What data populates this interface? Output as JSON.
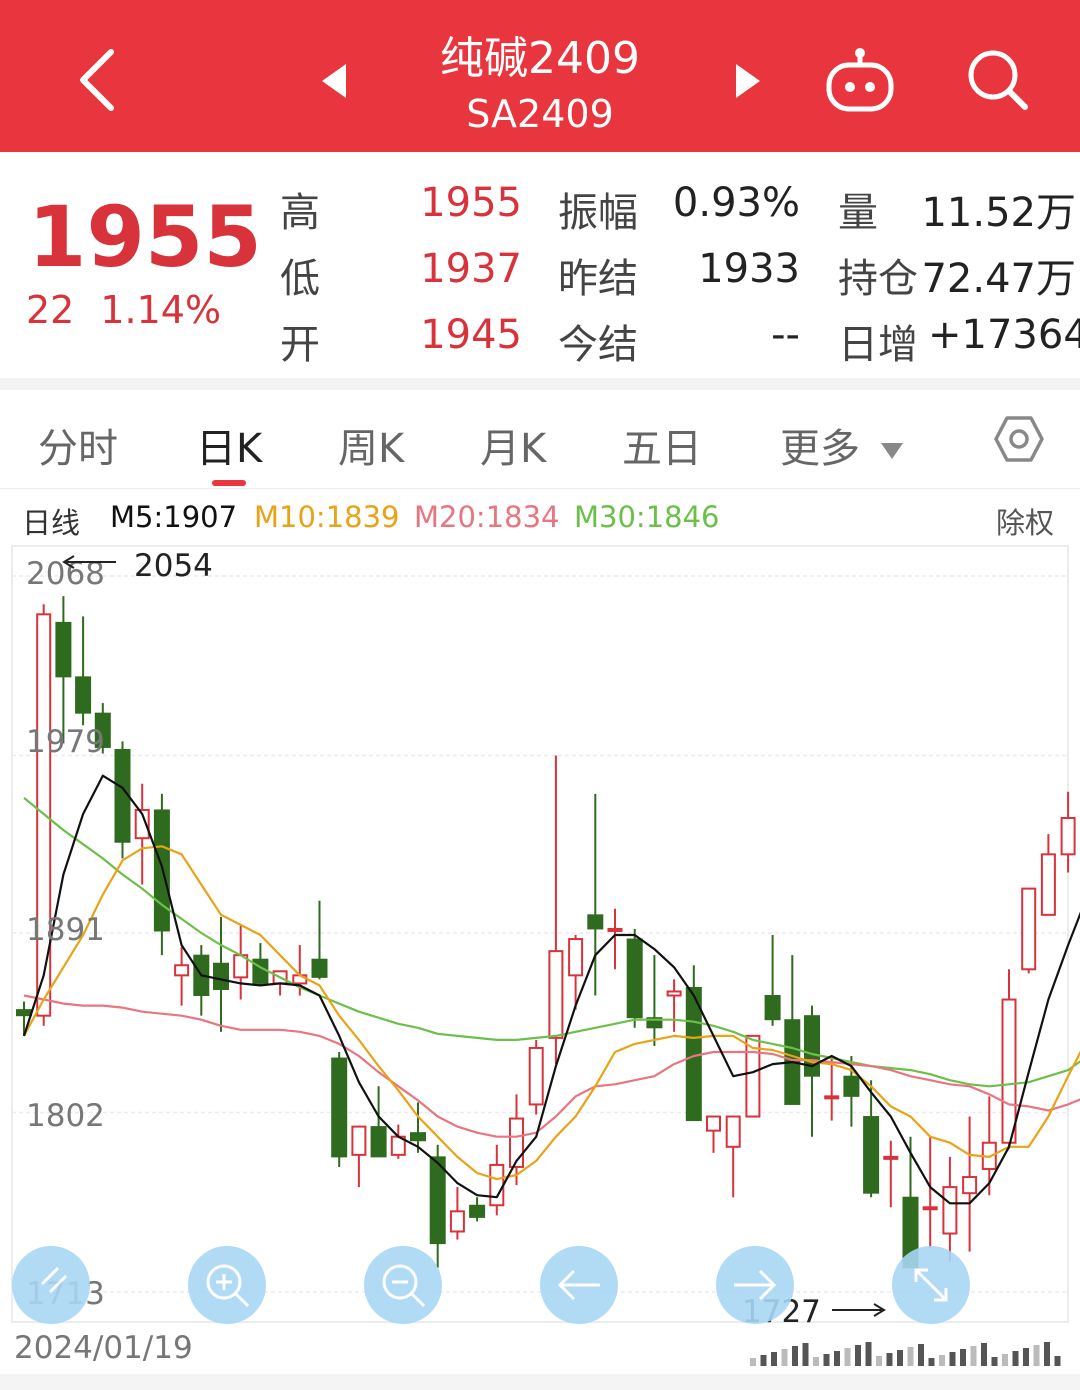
{
  "header": {
    "title": "纯碱2409",
    "subtitle": "SA2409"
  },
  "quote": {
    "price": "1955",
    "change": "22",
    "change_pct": "1.14%",
    "fields": [
      {
        "label": "高",
        "value": "1955"
      },
      {
        "label": "低",
        "value": "1937"
      },
      {
        "label": "开",
        "value": "1945"
      },
      {
        "label": "振幅",
        "value": "0.93%"
      },
      {
        "label": "昨结",
        "value": "1933"
      },
      {
        "label": "今结",
        "value": "--"
      },
      {
        "label": "量",
        "value": "11.52万"
      },
      {
        "label": "持仓",
        "value": "72.47万"
      },
      {
        "label": "日增",
        "value": "+17364"
      }
    ]
  },
  "tabs": [
    {
      "label": "分时"
    },
    {
      "label": "日K"
    },
    {
      "label": "周K"
    },
    {
      "label": "月K"
    },
    {
      "label": "五日"
    },
    {
      "label": "更多"
    }
  ],
  "ma_legend": {
    "period": "日线",
    "m5": "M5:1907",
    "m10": "M10:1839",
    "m20": "M20:1834",
    "m30": "M30:1846",
    "adjust": "除权"
  },
  "colors": {
    "up": "#d8323a",
    "down": "#2e6b1f",
    "m5": "#111111",
    "m10": "#e8a317",
    "m20": "#e8757f",
    "m30": "#6cc04a",
    "accent": "#e8353e"
  },
  "chart_data": {
    "type": "candlestick",
    "y_ticks": [
      "2068",
      "1979",
      "1891",
      "1802",
      "1713"
    ],
    "ylim": [
      1705,
      2080
    ],
    "annotations": {
      "max": "2054",
      "min": "1727"
    },
    "start_date": "2024/01/19",
    "candles": [
      [
        1853,
        1857,
        1840,
        1850
      ],
      [
        1850,
        2054,
        1845,
        2049
      ],
      [
        2045,
        2058,
        1985,
        2018
      ],
      [
        2018,
        2048,
        1994,
        2000
      ],
      [
        2000,
        2005,
        1980,
        1983
      ],
      [
        1982,
        1986,
        1928,
        1936
      ],
      [
        1938,
        1965,
        1915,
        1952
      ],
      [
        1952,
        1960,
        1880,
        1892
      ],
      [
        1870,
        1884,
        1855,
        1875
      ],
      [
        1880,
        1885,
        1850,
        1860
      ],
      [
        1876,
        1899,
        1842,
        1863
      ],
      [
        1869,
        1895,
        1858,
        1880
      ],
      [
        1878,
        1886,
        1865,
        1866
      ],
      [
        1866,
        1872,
        1860,
        1872
      ],
      [
        1866,
        1885,
        1860,
        1870
      ],
      [
        1878,
        1907,
        1868,
        1869
      ],
      [
        1829,
        1832,
        1775,
        1780
      ],
      [
        1781,
        1794,
        1765,
        1795
      ],
      [
        1795,
        1815,
        1780,
        1780
      ],
      [
        1781,
        1796,
        1779,
        1790
      ],
      [
        1792,
        1807,
        1782,
        1788
      ],
      [
        1780,
        1786,
        1725,
        1737
      ],
      [
        1743,
        1765,
        1739,
        1753
      ],
      [
        1756,
        1760,
        1748,
        1750
      ],
      [
        1756,
        1786,
        1751,
        1776
      ],
      [
        1775,
        1811,
        1766,
        1799
      ],
      [
        1806,
        1838,
        1801,
        1834
      ],
      [
        1839,
        1979,
        1826,
        1882
      ],
      [
        1870,
        1890,
        1853,
        1888
      ],
      [
        1900,
        1960,
        1860,
        1893
      ],
      [
        1893,
        1903,
        1873,
        1893
      ],
      [
        1888,
        1893,
        1844,
        1849
      ],
      [
        1849,
        1880,
        1835,
        1844
      ],
      [
        1860,
        1868,
        1842,
        1862
      ],
      [
        1864,
        1875,
        1810,
        1798
      ],
      [
        1793,
        1800,
        1782,
        1800
      ],
      [
        1785,
        1800,
        1760,
        1800
      ],
      [
        1800,
        1840,
        1800,
        1840
      ],
      [
        1860,
        1890,
        1845,
        1848
      ],
      [
        1848,
        1880,
        1830,
        1806
      ],
      [
        1850,
        1855,
        1790,
        1820
      ],
      [
        1809,
        1830,
        1798,
        1810
      ],
      [
        1820,
        1830,
        1795,
        1810
      ],
      [
        1800,
        1818,
        1760,
        1762
      ],
      [
        1780,
        1788,
        1755,
        1780
      ],
      [
        1760,
        1790,
        1725,
        1725
      ],
      [
        1755,
        1790,
        1735,
        1755
      ],
      [
        1742,
        1780,
        1728,
        1765
      ],
      [
        1762,
        1800,
        1733,
        1770
      ],
      [
        1774,
        1810,
        1761,
        1787
      ],
      [
        1787,
        1873,
        1784,
        1858
      ],
      [
        1873,
        1903,
        1871,
        1913
      ],
      [
        1900,
        1940,
        1900,
        1930
      ],
      [
        1930,
        1961,
        1921,
        1948
      ],
      [
        1945,
        1955,
        1937,
        1955
      ]
    ],
    "m5": [
      1840,
      1870,
      1920,
      1950,
      1969,
      1963,
      1950,
      1924,
      1885,
      1870,
      1868,
      1866,
      1865,
      1866,
      1865,
      1860,
      1840,
      1817,
      1800,
      1790,
      1785,
      1777,
      1767,
      1761,
      1760,
      1778,
      1790,
      1825,
      1855,
      1880,
      1890,
      1890,
      1883,
      1874,
      1860,
      1840,
      1820,
      1822,
      1826,
      1827,
      1825,
      1830,
      1825,
      1812,
      1800,
      1782,
      1765,
      1757,
      1757,
      1767,
      1785,
      1822,
      1858,
      1885,
      1910
    ],
    "m10": [
      1840,
      1858,
      1874,
      1890,
      1910,
      1927,
      1933,
      1934,
      1930,
      1915,
      1900,
      1895,
      1890,
      1880,
      1870,
      1865,
      1850,
      1838,
      1825,
      1813,
      1800,
      1790,
      1780,
      1772,
      1769,
      1771,
      1778,
      1790,
      1800,
      1815,
      1832,
      1836,
      1838,
      1840,
      1839,
      1840,
      1840,
      1834,
      1833,
      1830,
      1827,
      1826,
      1823,
      1815,
      1805,
      1800,
      1790,
      1787,
      1781,
      1780,
      1785,
      1785,
      1800,
      1820,
      1839
    ],
    "m20": [
      1860,
      1858,
      1856,
      1855,
      1855,
      1854,
      1852,
      1851,
      1850,
      1848,
      1845,
      1843,
      1843,
      1843,
      1842,
      1840,
      1836,
      1830,
      1822,
      1815,
      1808,
      1800,
      1795,
      1792,
      1790,
      1790,
      1792,
      1800,
      1810,
      1815,
      1816,
      1818,
      1820,
      1826,
      1830,
      1832,
      1832,
      1832,
      1831,
      1828,
      1828,
      1827,
      1826,
      1825,
      1823,
      1820,
      1818,
      1816,
      1815,
      1811,
      1806,
      1805,
      1803,
      1806,
      1810
    ],
    "m30": [
      1958,
      1950,
      1942,
      1935,
      1928,
      1920,
      1913,
      1905,
      1898,
      1891,
      1885,
      1880,
      1874,
      1869,
      1864,
      1860,
      1856,
      1852,
      1849,
      1846,
      1844,
      1841,
      1840,
      1839,
      1838,
      1838,
      1839,
      1840,
      1842,
      1844,
      1846,
      1848,
      1848,
      1848,
      1847,
      1845,
      1842,
      1838,
      1836,
      1834,
      1831,
      1829,
      1827,
      1825,
      1824,
      1823,
      1821,
      1818,
      1816,
      1815,
      1816,
      1817,
      1820,
      1823,
      1830
    ]
  },
  "fabs": [
    "zoom-in",
    "zoom-out",
    "scroll-left",
    "scroll-right",
    "fullscreen"
  ]
}
